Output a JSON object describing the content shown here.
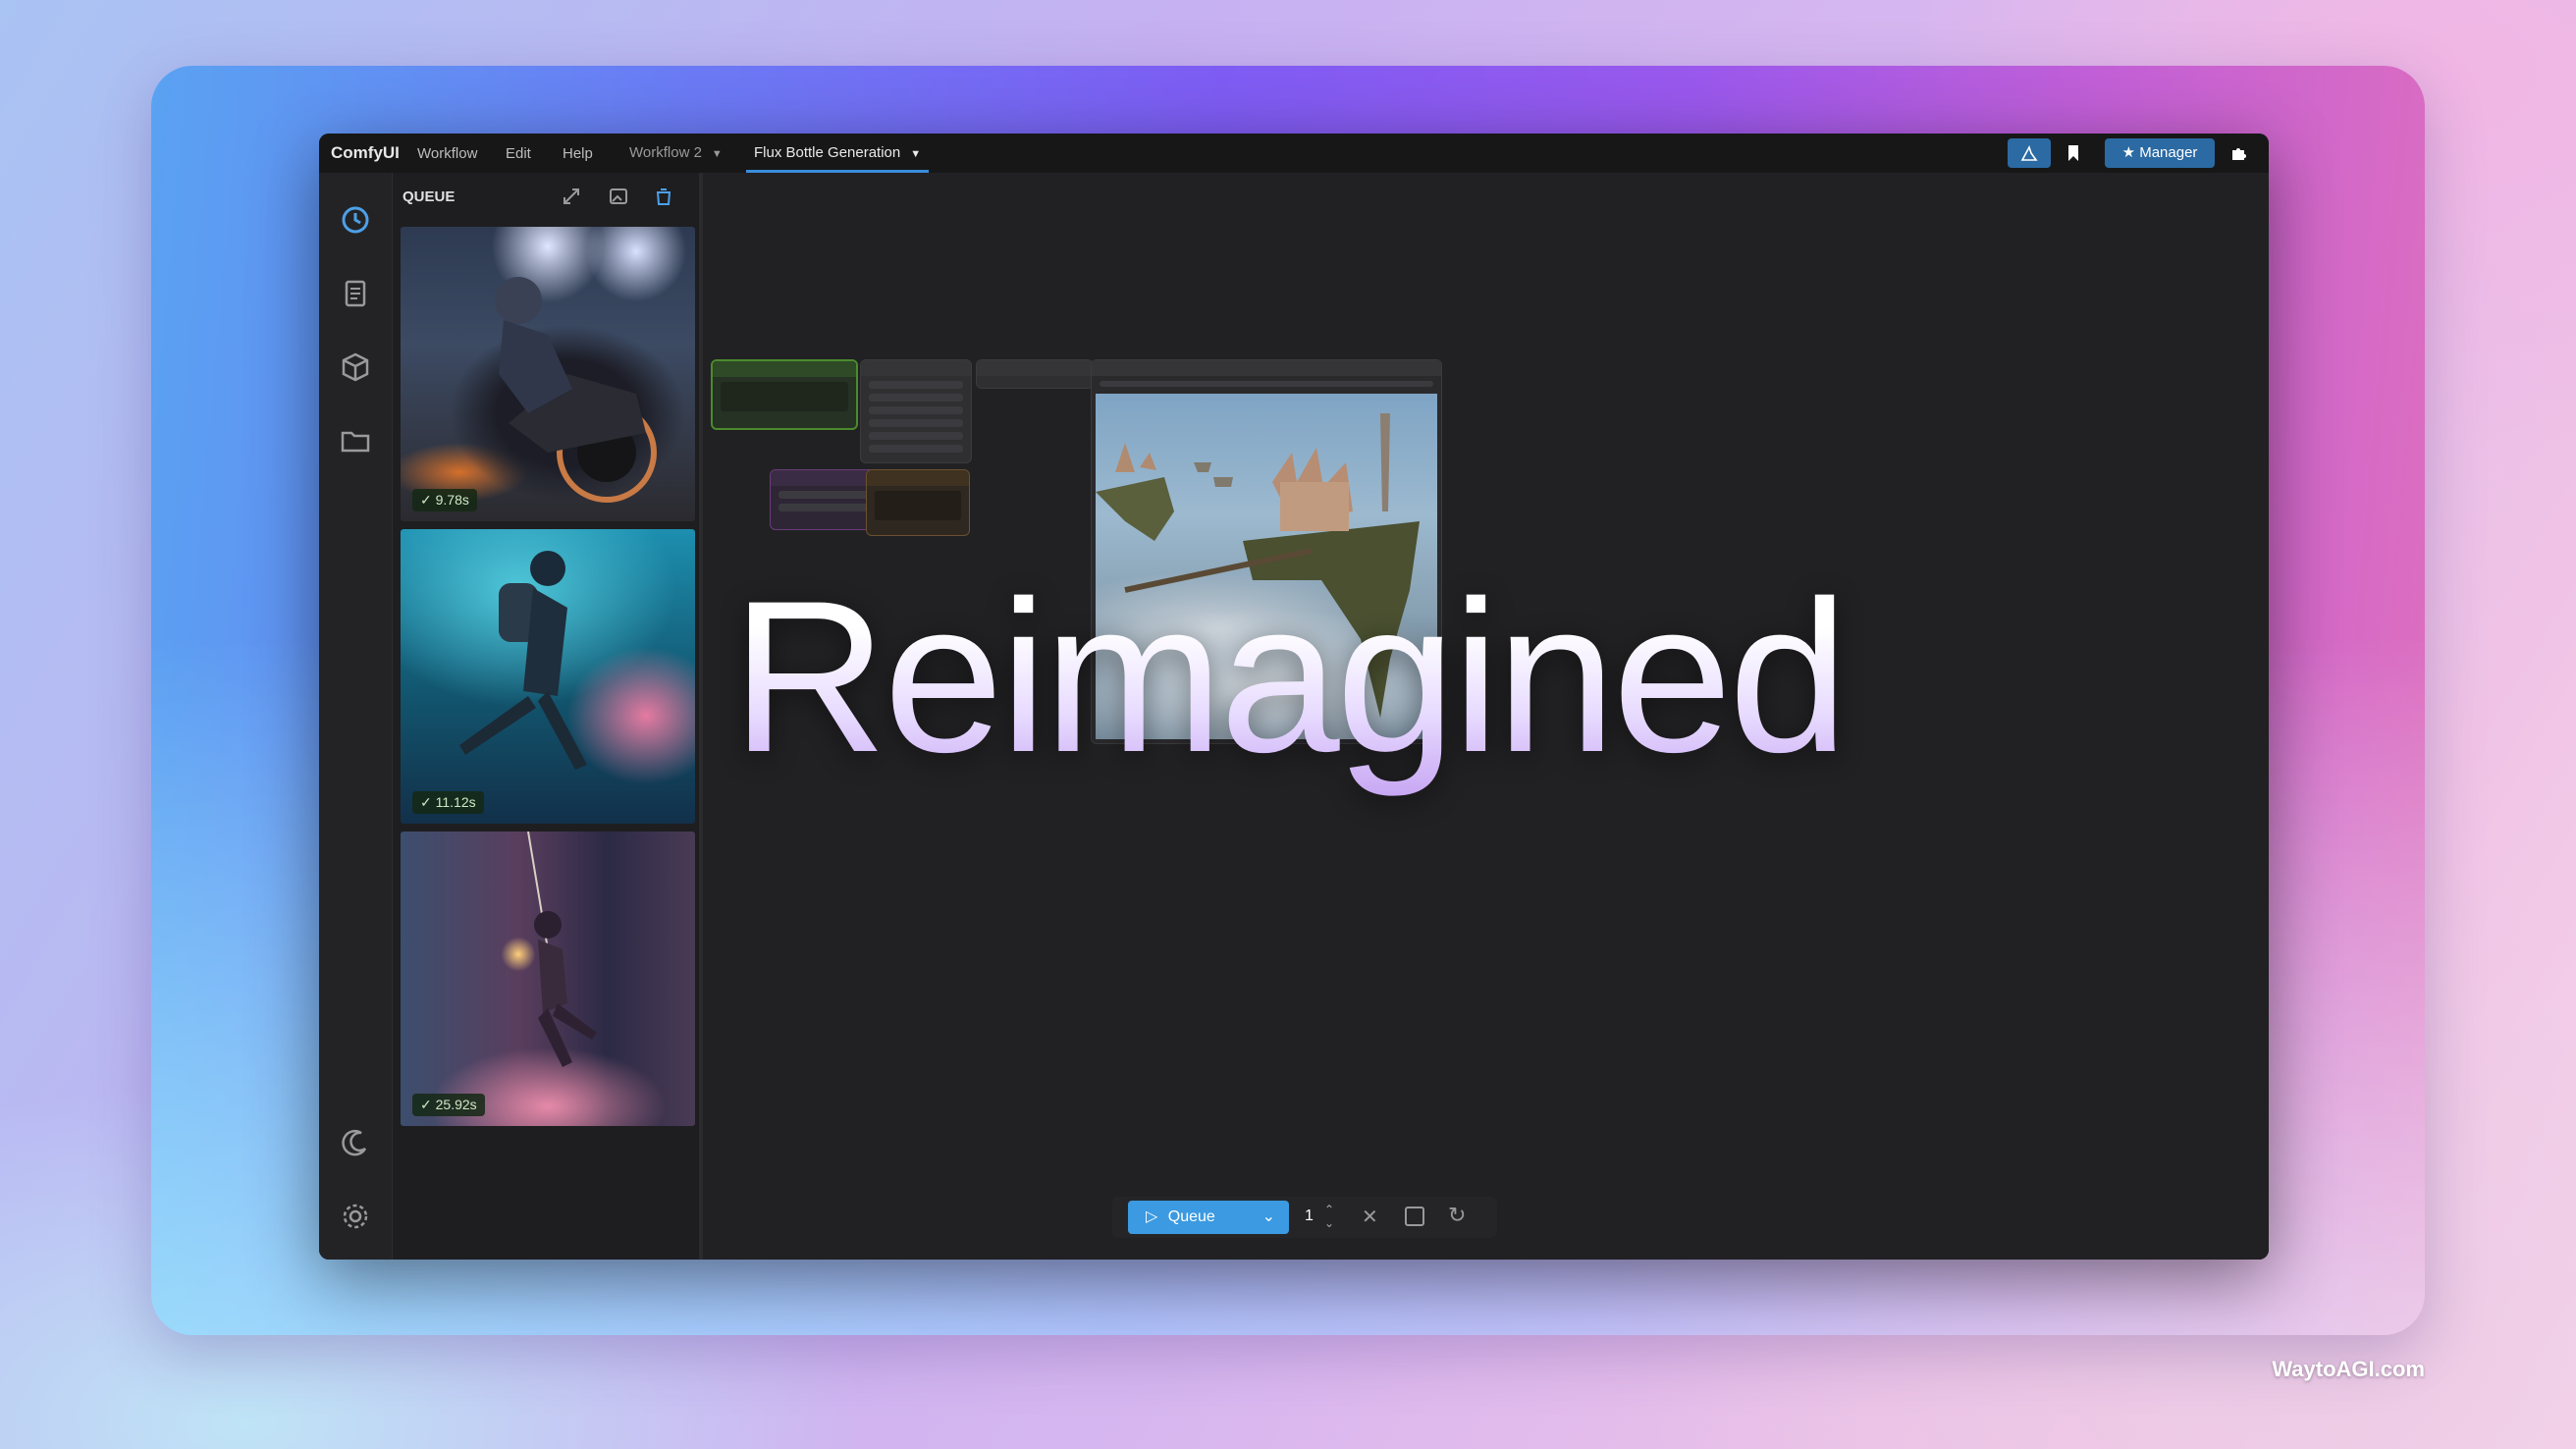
{
  "menubar": {
    "app_name": "ComfyUI",
    "menus": [
      "Workflow",
      "Edit",
      "Help"
    ],
    "tabs": [
      {
        "label": "Workflow 2",
        "active": false
      },
      {
        "label": "Flux Bottle Generation",
        "active": true
      }
    ],
    "manager_label": "Manager"
  },
  "queue_panel": {
    "title": "QUEUE",
    "items": [
      {
        "time": "9.78s",
        "subject": "motorcycle rider in tunnel"
      },
      {
        "time": "11.12s",
        "subject": "diver among coral"
      },
      {
        "time": "25.92s",
        "subject": "figure swinging with lantern"
      }
    ]
  },
  "headline": "Reimagined",
  "bottom_toolbar": {
    "queue_label": "Queue",
    "batch_count": "1"
  },
  "watermark": "WaytoAGI.com",
  "colors": {
    "accent": "#3b9ae1",
    "window_bg": "#1c1c1e",
    "canvas_bg": "#212123"
  },
  "icons": {
    "left_bar": [
      "history-icon",
      "document-icon",
      "cube-icon",
      "folder-icon",
      "moon-icon",
      "gear-icon"
    ],
    "canvas_tools": [
      "plus-icon",
      "minus-icon",
      "fit-view-icon",
      "send-icon",
      "eye-icon"
    ]
  }
}
